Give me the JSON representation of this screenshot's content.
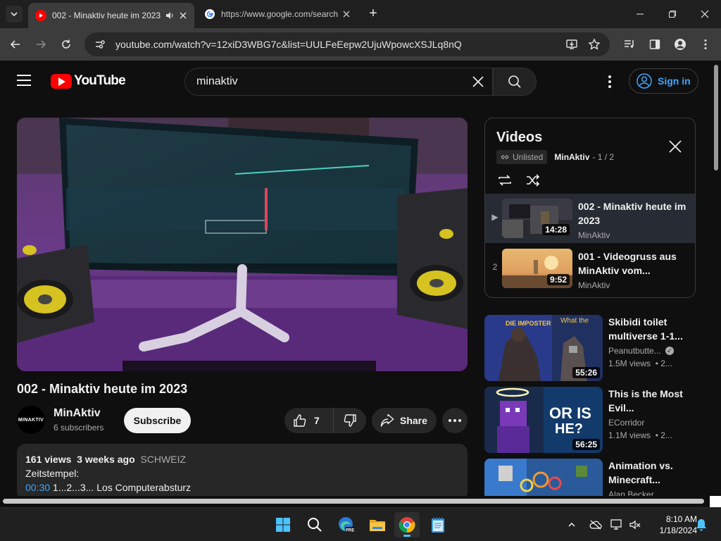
{
  "browser": {
    "tabs": [
      {
        "title": "002 - Minaktiv heute im 2023",
        "favicon": "youtube-icon",
        "active": true
      },
      {
        "title": "https://www.google.com/search?",
        "favicon": "google-icon",
        "active": false
      }
    ],
    "url": "youtube.com/watch?v=12xiD3WBG7c&list=UULFeEepw2UjuWpowcXSJLq8nQ"
  },
  "youtube": {
    "logo": "YouTube",
    "search_query": "minaktiv",
    "signin_label": "Sign in"
  },
  "video": {
    "title": "002 - Minaktiv heute im 2023",
    "channel": "MinAktiv",
    "channel_avatar_text": "MINAKTIV",
    "subscribers": "6 subscribers",
    "subscribe_label": "Subscribe",
    "likes": "7",
    "share_label": "Share",
    "views": "161 views",
    "date": "3 weeks ago",
    "tag": "SCHWEIZ",
    "desc_line1": "Zeitstempel:",
    "desc_ts": "00:30",
    "desc_line2": " 1...2...3... Los Computerabsturz"
  },
  "playlist": {
    "title": "Videos",
    "badge": "Unlisted",
    "owner": "MinAktiv",
    "position": "- 1 / 2",
    "items": [
      {
        "index": "▶",
        "title": "002 - Minaktiv heute im 2023",
        "channel": "MinAktiv",
        "duration": "14:28"
      },
      {
        "index": "2",
        "title": "001 - Videogruss aus MinAktiv vom...",
        "channel": "MinAktiv",
        "duration": "9:52"
      }
    ]
  },
  "recommendations": [
    {
      "title": "Skibidi toilet multiverse 1-1...",
      "channel": "Peanutbutte...",
      "verified": true,
      "views": "1.5M views",
      "age": "• 2...",
      "duration": "55:26",
      "thumb_text1": "DIE IMPOSTER",
      "thumb_text2": "What the"
    },
    {
      "title": "This is the Most Evil...",
      "channel": "ECorridor",
      "verified": false,
      "views": "1.1M views",
      "age": "• 2...",
      "duration": "56:25",
      "thumb_text1": "OR IS",
      "thumb_text2": "HE?"
    },
    {
      "title": "Animation vs. Minecraft...",
      "channel": "Alan Becker",
      "verified": false,
      "views": "",
      "age": "",
      "duration": "",
      "thumb_text1": "",
      "thumb_text2": ""
    }
  ],
  "taskbar": {
    "time": "8:10 AM",
    "date": "1/18/2024",
    "apps": [
      "windows-start-icon",
      "search-icon",
      "edge-beta-icon",
      "file-explorer-icon",
      "chrome-icon",
      "notepad-icon"
    ]
  },
  "colors": {
    "youtube_red": "#ff0000",
    "link_blue": "#3ea6ff",
    "background": "#0f0f0f"
  }
}
